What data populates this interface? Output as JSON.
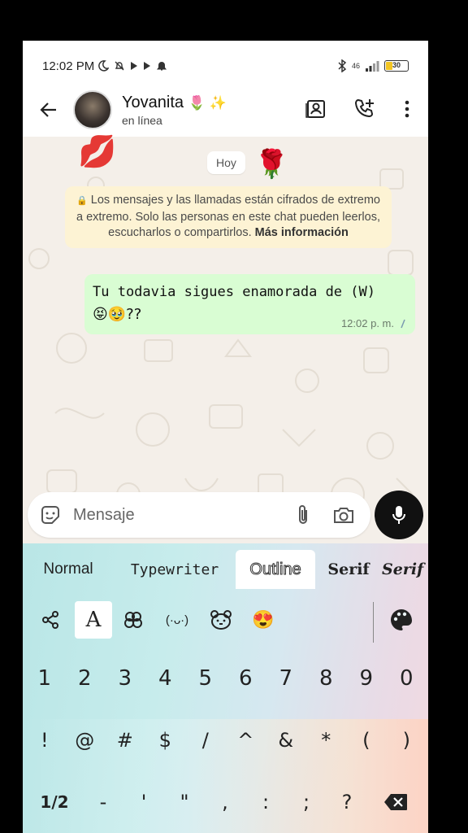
{
  "status": {
    "time": "12:02 PM",
    "network": "46",
    "battery": "30"
  },
  "header": {
    "name": "Yovanita",
    "name_emoji": "🌷 ✨",
    "status": "en línea"
  },
  "chat": {
    "date_chip": "Hoy",
    "sticker_lips": "💋",
    "sticker_rose": "🌹",
    "encryption_text": "Los mensajes y las llamadas están cifrados de extremo a extremo. Solo las personas en este chat pueden leerlos, escucharlos o compartirlos.",
    "encryption_link": "Más información",
    "messages": [
      {
        "text_line1": "Tu todavia sigues enamorada de (W)",
        "text_line2": "😝🥹??",
        "time": "12:02 p. m."
      }
    ]
  },
  "input": {
    "placeholder": "Mensaje"
  },
  "keyboard": {
    "font_styles": [
      "Normal",
      "Typewriter",
      "Outline",
      "Serif",
      "Serif"
    ],
    "active_font": "Outline",
    "tools": {
      "text_style_label": "A",
      "kaomoji": "(·ᴗ·)",
      "emoji": "😍"
    },
    "number_row": [
      "1",
      "2",
      "3",
      "4",
      "5",
      "6",
      "7",
      "8",
      "9",
      "0"
    ],
    "symbol_row": [
      "!",
      "@",
      "#",
      "$",
      "/",
      "^",
      "&",
      "*",
      "(",
      ")"
    ],
    "bottom_row": [
      "1/2",
      "-",
      "'",
      "\"",
      ",",
      ":",
      ";",
      "?"
    ]
  },
  "colors": {
    "outgoing_bubble": "#d9fdd3",
    "notice_bg": "#fdf3d4",
    "chat_bg": "#f4efe9"
  }
}
